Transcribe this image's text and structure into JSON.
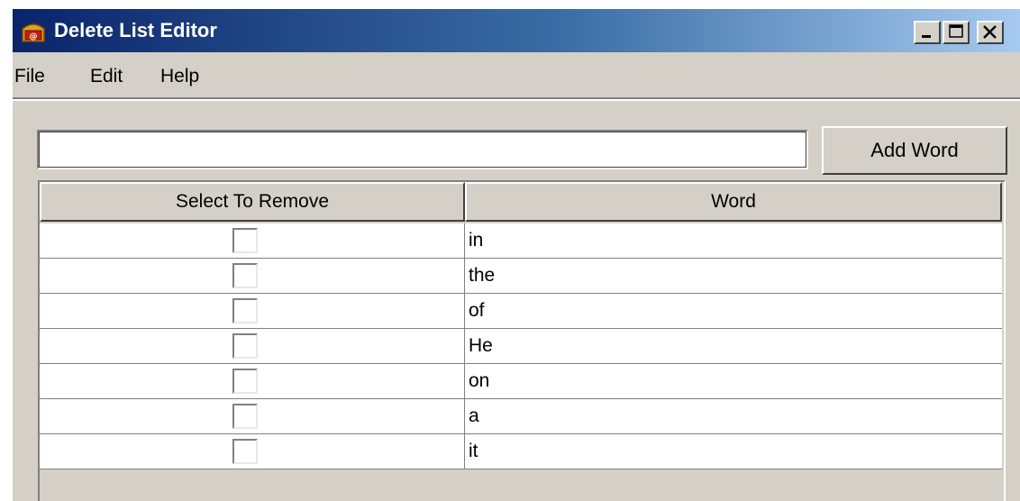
{
  "window": {
    "title": "Delete List Editor",
    "icon": "app-icon"
  },
  "caption_buttons": {
    "minimize": "minimize-icon",
    "maximize": "maximize-icon",
    "close": "close-icon"
  },
  "menu": {
    "items": [
      "File",
      "Edit",
      "Help"
    ]
  },
  "input": {
    "value": "",
    "add_label": "Add Word"
  },
  "table": {
    "columns": [
      "Select To Remove",
      "Word"
    ],
    "rows": [
      {
        "checked": false,
        "word": "in"
      },
      {
        "checked": false,
        "word": "the"
      },
      {
        "checked": false,
        "word": "of"
      },
      {
        "checked": false,
        "word": "He"
      },
      {
        "checked": false,
        "word": "on"
      },
      {
        "checked": false,
        "word": "a"
      },
      {
        "checked": false,
        "word": "it"
      }
    ]
  },
  "colors": {
    "title_start": "#0a246a",
    "title_end": "#a6caf0",
    "face": "#d4d0c8"
  }
}
